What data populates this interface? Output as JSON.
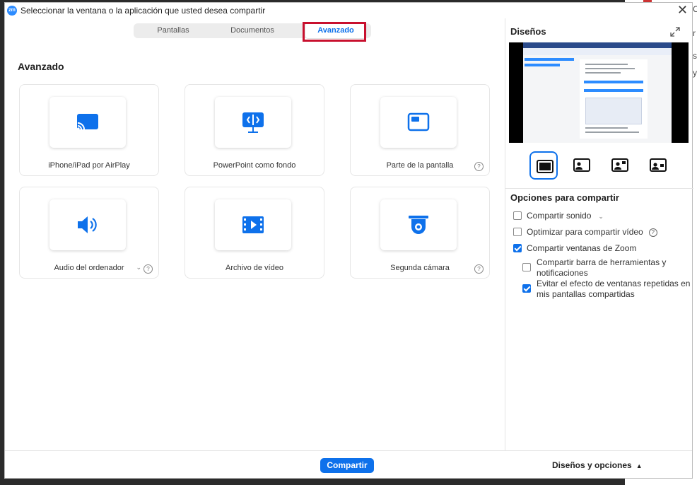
{
  "window": {
    "logo_text": "zm",
    "title": "Seleccionar la ventana o la aplicación que usted desea compartir",
    "close_glyph": "✕"
  },
  "tabs": [
    {
      "label": "Pantallas",
      "selected": false
    },
    {
      "label": "Documentos",
      "selected": false
    },
    {
      "label": "Avanzado",
      "selected": true
    }
  ],
  "section_title": "Avanzado",
  "cards": [
    {
      "label": "iPhone/iPad por AirPlay",
      "icon": "airplay-icon",
      "help": false
    },
    {
      "label": "PowerPoint como fondo",
      "icon": "powerpoint-background-icon",
      "help": false
    },
    {
      "label": "Parte de la pantalla",
      "icon": "screen-portion-icon",
      "help": true
    },
    {
      "label": "Audio del ordenador",
      "icon": "speaker-icon",
      "help": true,
      "dropdown": true
    },
    {
      "label": "Archivo de vídeo",
      "icon": "video-file-icon",
      "help": false
    },
    {
      "label": "Segunda cámara",
      "icon": "second-camera-icon",
      "help": true
    }
  ],
  "help_glyph": "?",
  "chevron_glyph": "⌄",
  "right_panel": {
    "title": "Diseños",
    "layouts": [
      "screen-only-layout-icon",
      "screen-left-presenter-layout-icon",
      "screen-center-presenter-layout-icon",
      "screen-right-presenter-layout-icon"
    ],
    "selected_layout": 0
  },
  "options": {
    "title": "Opciones para compartir",
    "share_sound": {
      "label": "Compartir sonido",
      "checked": false
    },
    "optimize_video": {
      "label": "Optimizar para compartir vídeo",
      "checked": false
    },
    "share_zoom_windows": {
      "label": "Compartir ventanas de Zoom",
      "checked": true
    },
    "share_toolbar": {
      "label": "Compartir barra de herramientas y notificaciones",
      "checked": false
    },
    "avoid_repeat": {
      "label": "Evitar el efecto de ventanas repetidas en mis pantallas compartidas",
      "checked": true
    }
  },
  "footer": {
    "share_label": "Compartir",
    "layouts_options_label": "Diseños y opciones",
    "caret": "▲"
  },
  "background_edge_text": [
    "C",
    "r",
    "s",
    "y"
  ],
  "colors": {
    "accent": "#0e71eb",
    "highlight": "#c8102e"
  }
}
